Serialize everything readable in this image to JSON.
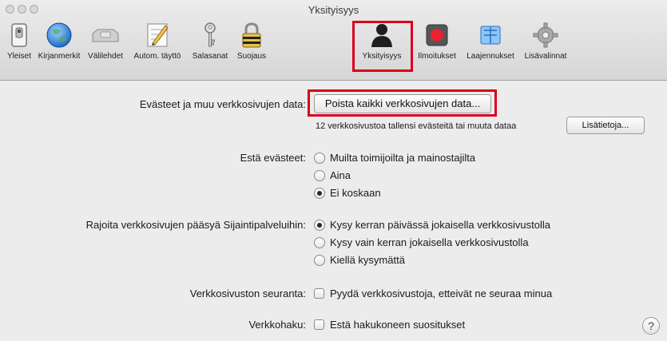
{
  "window": {
    "title": "Yksityisyys"
  },
  "toolbar": {
    "items": [
      {
        "label": "Yleiset",
        "icon": "switch-icon"
      },
      {
        "label": "Kirjanmerkit",
        "icon": "globe-icon"
      },
      {
        "label": "Välilehdet",
        "icon": "tabs-icon"
      },
      {
        "label": "Autom. täyttö",
        "icon": "pencil-form-icon"
      },
      {
        "label": "Salasanat",
        "icon": "key-icon"
      },
      {
        "label": "Suojaus",
        "icon": "padlock-icon"
      },
      {
        "label": "Yksityisyys",
        "icon": "person-silhouette-icon"
      },
      {
        "label": "Ilmoitukset",
        "icon": "notification-icon"
      },
      {
        "label": "Laajennukset",
        "icon": "puzzle-icon"
      },
      {
        "label": "Lisävalinnat",
        "icon": "gear-icon"
      }
    ],
    "selected": "Yksityisyys"
  },
  "cookies": {
    "label": "Evästeet ja muu verkkosivujen data:",
    "remove_button": "Poista kaikki verkkosivujen data...",
    "info_text": "12 verkkosivustoa tallensi evästeitä tai muuta dataa",
    "details_button": "Lisätietoja..."
  },
  "block_cookies": {
    "label": "Estä evästeet:",
    "options": [
      "Muilta toimijoilta ja mainostajilta",
      "Aina",
      "Ei koskaan"
    ],
    "selected": "Ei koskaan"
  },
  "location": {
    "label": "Rajoita verkkosivujen pääsyä Sijaintipalveluihin:",
    "options": [
      "Kysy kerran päivässä jokaisella verkkosivustolla",
      "Kysy vain kerran jokaisella verkkosivustolla",
      "Kiellä kysymättä"
    ],
    "selected": "Kysy kerran päivässä jokaisella verkkosivustolla"
  },
  "tracking": {
    "label": "Verkkosivuston seuranta:",
    "option": "Pyydä verkkosivustoja, etteivät ne seuraa minua",
    "checked": false
  },
  "search": {
    "label": "Verkkohaku:",
    "option": "Estä hakukoneen suositukset",
    "checked": false
  },
  "help": {
    "label": "?"
  },
  "colors": {
    "highlight": "#d9001b",
    "window_bg": "#ececec"
  }
}
